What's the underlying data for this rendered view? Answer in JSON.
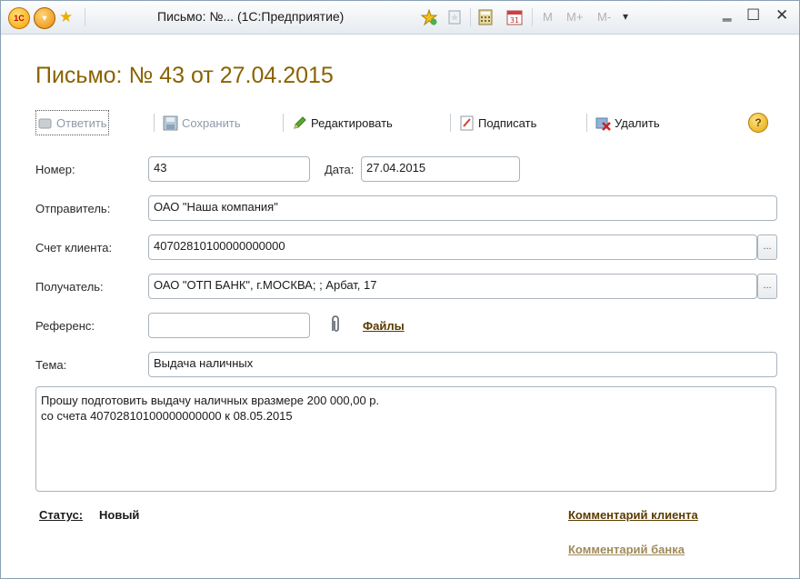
{
  "window": {
    "title": "Письмо: №... (1С:Предприятие)",
    "logo_text": "1C",
    "m_buttons": [
      "M",
      "M+",
      "M-"
    ]
  },
  "form": {
    "title": "Письмо: № 43 от 27.04.2015"
  },
  "toolbar": {
    "reply": "Ответить",
    "save": "Сохранить",
    "edit": "Редактировать",
    "sign": "Подписать",
    "delete": "Удалить",
    "help": "?"
  },
  "fields": {
    "number_label": "Номер:",
    "number": "43",
    "date_label": "Дата:",
    "date": "27.04.2015",
    "sender_label": "Отправитель:",
    "sender": "ОАО \"Наша компания\"",
    "account_label": "Счет клиента:",
    "account": "40702810100000000000",
    "recipient_label": "Получатель:",
    "recipient": "ОАО \"ОТП БАНК\", г.МОСКВА; ; Арбат, 17",
    "reference_label": "Референс:",
    "reference": "",
    "files_link": "Файлы",
    "subject_label": "Тема:",
    "subject": "Выдача наличных",
    "body": "Прошу подготовить выдачу наличных вразмере 200 000,00 р.\nсо счета 40702810100000000000 к 08.05.2015"
  },
  "status": {
    "label": "Статус:",
    "value": "Новый",
    "client_comment": "Комментарий клиента",
    "bank_comment": "Комментарий банка"
  },
  "colors": {
    "title": "#8a6200",
    "link_active": "#5a3b00",
    "link_muted": "#a08a5a",
    "disabled_text": "#8f9aa6"
  }
}
